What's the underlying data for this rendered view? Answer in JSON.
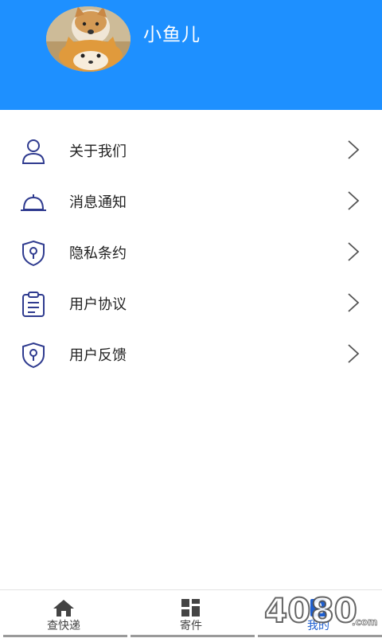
{
  "header": {
    "username": "小鱼儿",
    "avatar_icon": "shiba-dog-avatar",
    "background_color": "#1e90ff"
  },
  "menu": {
    "items": [
      {
        "label": "关于我们",
        "icon": "user-icon"
      },
      {
        "label": "消息通知",
        "icon": "bell-icon"
      },
      {
        "label": "隐私条约",
        "icon": "shield-icon"
      },
      {
        "label": "用户协议",
        "icon": "clipboard-icon"
      },
      {
        "label": "用户反馈",
        "icon": "shield-icon"
      }
    ],
    "icon_color": "#2f3b8f"
  },
  "tabbar": {
    "tabs": [
      {
        "label": "查快递",
        "icon": "home-icon",
        "active": false
      },
      {
        "label": "寄件",
        "icon": "grid-icon",
        "active": false
      },
      {
        "label": "我的",
        "icon": "profile-icon",
        "active": true
      }
    ],
    "active_color": "#1e5fd0"
  },
  "watermark": {
    "text": "4080",
    "suffix": ".com"
  }
}
